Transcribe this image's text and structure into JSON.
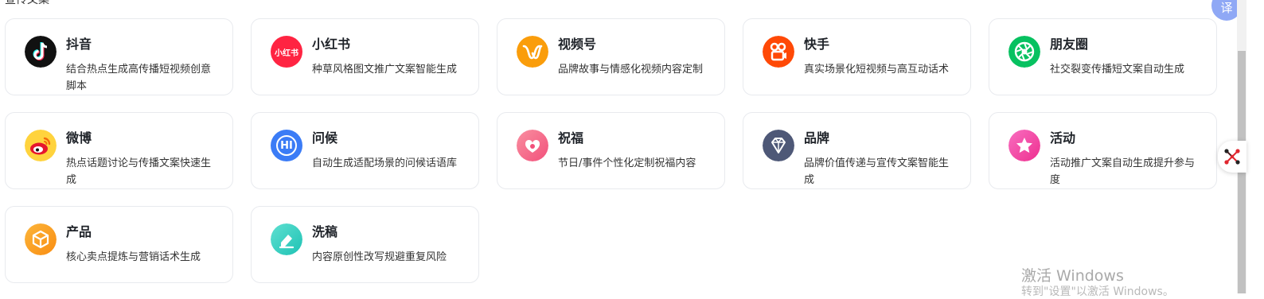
{
  "section": {
    "title": "宣传文案"
  },
  "cards": [
    {
      "title": "抖音",
      "desc": "结合热点生成高传播短视频创意脚本",
      "icon": "douyin-icon",
      "color": "#1a1a1a"
    },
    {
      "title": "小红书",
      "desc": "种草风格图文推广文案智能生成",
      "icon": "xiaohongshu-icon",
      "color": "#ff2442",
      "icon_text": "小红书"
    },
    {
      "title": "视频号",
      "desc": "品牌故事与情感化视频内容定制",
      "icon": "shipinhao-icon",
      "color": "#fa9d0b"
    },
    {
      "title": "快手",
      "desc": "真实场景化短视频与高互动话术",
      "icon": "kuaishou-icon",
      "color": "#ff4906"
    },
    {
      "title": "朋友圈",
      "desc": "社交裂变传播短文案自动生成",
      "icon": "moments-icon",
      "color": "#07c160"
    },
    {
      "title": "微博",
      "desc": "热点话题讨论与传播文案快速生成",
      "icon": "weibo-icon",
      "color": "#ffd33d"
    },
    {
      "title": "问候",
      "desc": "自动生成适配场景的问候话语库",
      "icon": "greeting-icon",
      "color": "#3b7cf6",
      "icon_text": "HI"
    },
    {
      "title": "祝福",
      "desc": "节日/事件个性化定制祝福内容",
      "icon": "blessing-icon",
      "color": "#f76b8a"
    },
    {
      "title": "品牌",
      "desc": "品牌价值传递与宣传文案智能生成",
      "icon": "brand-diamond-icon",
      "color": "#4e5877"
    },
    {
      "title": "活动",
      "desc": "活动推广文案自动生成提升参与度",
      "icon": "activity-star-icon",
      "color": "#f34fa8"
    },
    {
      "title": "产品",
      "desc": "核心卖点提炼与营销话术生成",
      "icon": "product-cube-icon",
      "color": "#fba21c"
    },
    {
      "title": "洗稿",
      "desc": "内容原创性改写规避重复风险",
      "icon": "rewrite-eraser-icon",
      "color": "#2fd0c3"
    }
  ],
  "translate_button": {
    "label": "译"
  },
  "watermark": {
    "line1": "激活 Windows",
    "line2": "转到\"设置\"以激活 Windows。"
  }
}
